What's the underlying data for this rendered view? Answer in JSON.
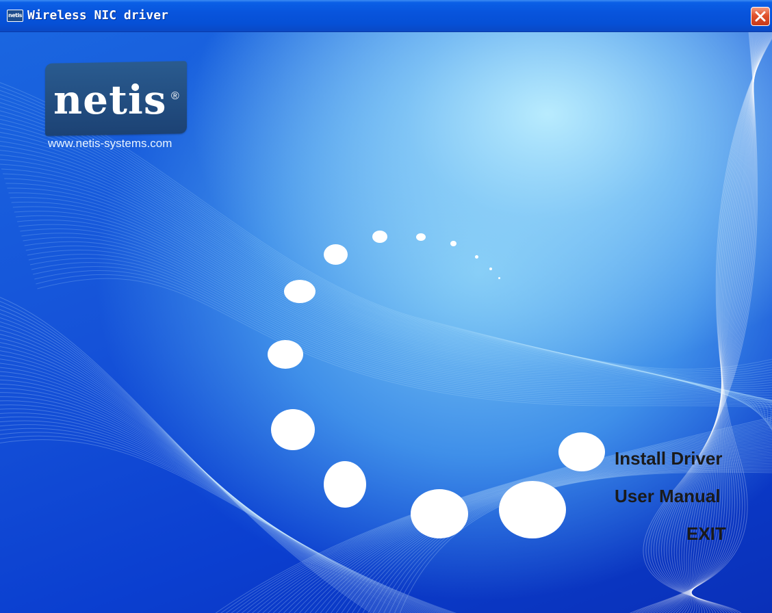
{
  "window": {
    "title": "Wireless NIC driver",
    "icon_label": "netis",
    "close_icon": "close-icon"
  },
  "logo": {
    "brand": "netis",
    "registered_mark": "®",
    "website": "www.netis-systems.com"
  },
  "menu": {
    "install_label": "Install Driver",
    "manual_label": "User Manual",
    "exit_label": "EXIT"
  },
  "colors": {
    "titlebar": "#0854dc",
    "background_blue": "#1552d8",
    "logo_box": "#1c4274",
    "close_button": "#e0512c",
    "menu_text": "#1a1a1a"
  }
}
